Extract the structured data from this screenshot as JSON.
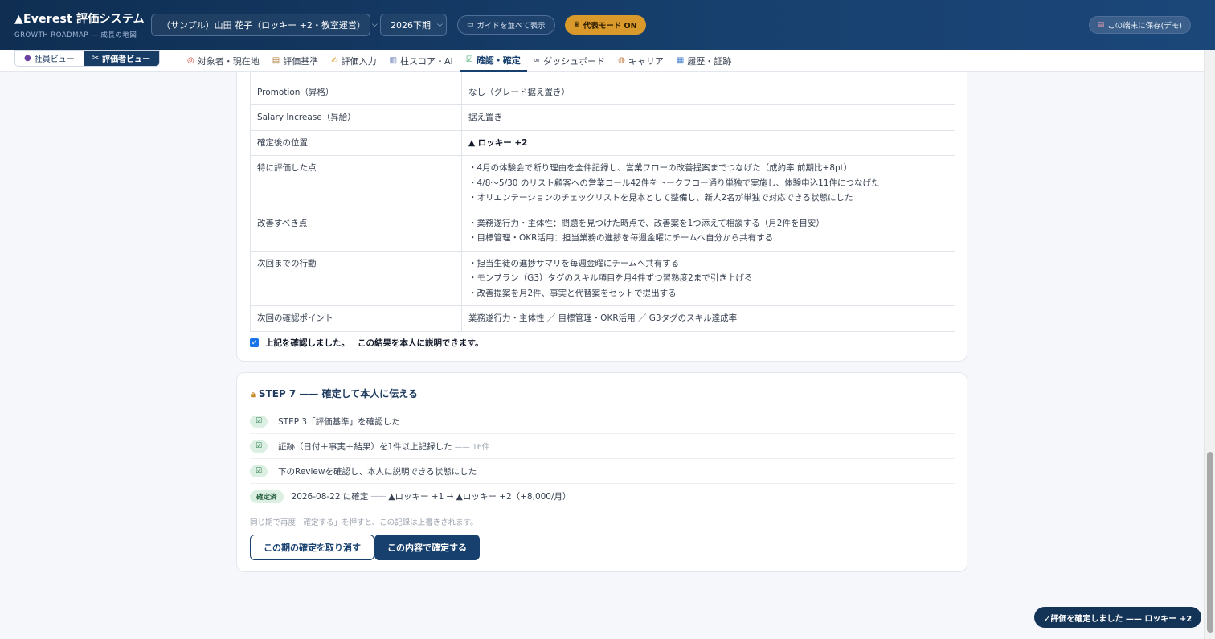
{
  "app": {
    "title": "▲Everest 評価システム",
    "subtitle": "GROWTH ROADMAP — 成長の地図"
  },
  "header": {
    "person_select": "（サンプル）山田 花子（ロッキー +2・教室運営）",
    "period_select": "2026下期",
    "guide_button": "ガイドを並べて表示",
    "rep_mode_button": "代表モード ON",
    "save_button": "この端末に保存(デモ)"
  },
  "view_toggle": {
    "staff": "社員ビュー",
    "evaluator": "評価者ビュー"
  },
  "tabs": [
    {
      "label": "対象者・現在地",
      "icon": "target-icon"
    },
    {
      "label": "評価基準",
      "icon": "clipboard-icon"
    },
    {
      "label": "評価入力",
      "icon": "pencil-icon"
    },
    {
      "label": "柱スコア・AI",
      "icon": "chart-icon"
    },
    {
      "label": "確認・確定",
      "icon": "check-box-icon"
    },
    {
      "label": "ダッシュボード",
      "icon": "glasses-icon"
    },
    {
      "label": "キャリア",
      "icon": "compass-icon"
    },
    {
      "label": "履歴・証跡",
      "icon": "books-icon"
    }
  ],
  "active_tab": "確認・確定",
  "review": {
    "rows": [
      {
        "label": "Promotion（昇格）",
        "lines": [
          "なし（グレード据え置き）"
        ]
      },
      {
        "label": "Salary Increase（昇給）",
        "lines": [
          "据え置き"
        ]
      },
      {
        "label": "確定後の位置",
        "lines": [
          "▲ ロッキー +2"
        ]
      },
      {
        "label": "特に評価した点",
        "lines": [
          "・4月の体験会で断り理由を全件記録し、営業フローの改善提案までつなげた（成約率 前期比+8pt）",
          "・4/8〜5/30 のリスト顧客への営業コール42件をトークフロー通り単独で実施し、体験申込11件につなげた",
          "・オリエンテーションのチェックリストを見本として整備し、新人2名が単独で対応できる状態にした"
        ]
      },
      {
        "label": "改善すべき点",
        "lines": [
          "・業務遂行力・主体性：問題を見つけた時点で、改善案を1つ添えて相談する（月2件を目安）",
          "・目標管理・OKR活用：担当業務の進捗を毎週金曜にチームへ自分から共有する"
        ]
      },
      {
        "label": "次回までの行動",
        "lines": [
          "・担当生徒の進捗サマリを毎週金曜にチームへ共有する",
          "・モンブラン（G3）タグのスキル項目を月4件ずつ習熟度2まで引き上げる",
          "・改善提案を月2件、事実と代替案をセットで提出する"
        ]
      },
      {
        "label": "次回の確認ポイント",
        "lines": [
          "業務遂行力・主体性 ／ 目標管理・OKR活用 ／ G3タグのスキル達成率"
        ]
      }
    ],
    "confirm_label": "上記を確認しました。",
    "confirm_statement": "この結果を本人に説明できます。",
    "confirmed": true
  },
  "step7": {
    "title": "STEP 7 —— 確定して本人に伝える",
    "checks": [
      {
        "text": "STEP 3「評価基準」を確認した",
        "note": ""
      },
      {
        "text": "証跡（日付＋事実＋結果）を1件以上記録した",
        "note": "—— 16件"
      },
      {
        "text": "下のReviewを確認し、本人に説明できる状態にした",
        "note": ""
      }
    ],
    "check_mark": "☑",
    "done_badge": "確定済",
    "done_text": "2026-08-22 に確定",
    "done_sep": "——",
    "done_transition": "▲ロッキー +1 → ▲ロッキー +2（+8,000/月）",
    "note": "同じ期で再度「確定する」を押すと、この記録は上書きされます。",
    "cancel_button": "この期の確定を取り消す",
    "confirm_button": "この内容で確定する"
  },
  "toast": "✓評価を確定しました —— ロッキー +2"
}
